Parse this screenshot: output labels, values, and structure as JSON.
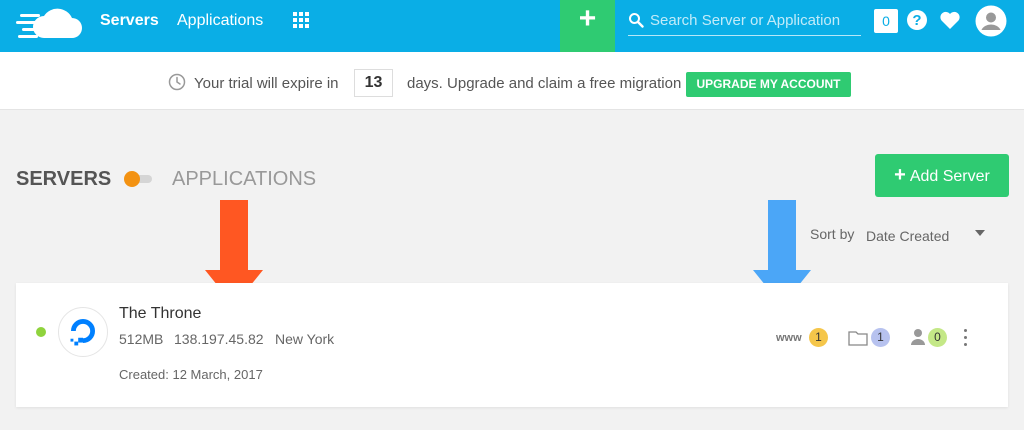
{
  "colors": {
    "topbar": "#0aaee6",
    "accent_green": "#2fcb72",
    "toggle_orange": "#f39212",
    "arrow_orange": "#ff5722",
    "arrow_blue": "#4ba6f7",
    "status_online": "#8fd33d"
  },
  "nav": {
    "servers": "Servers",
    "applications": "Applications",
    "plus": "+",
    "search_placeholder": "Search Server or Application",
    "notifications_count": "0",
    "icons": [
      "apps-grid-icon",
      "search-icon",
      "help-icon",
      "heart-icon",
      "avatar-icon"
    ]
  },
  "trial": {
    "prefix": "Your trial will expire in",
    "days": "13",
    "suffix": "days. Upgrade and claim a free migration",
    "upgrade_label": "UPGRADE MY ACCOUNT"
  },
  "section": {
    "servers_label": "SERVERS",
    "applications_label": "APPLICATIONS",
    "add_server_plus": "+",
    "add_server_label": "Add Server"
  },
  "sort": {
    "label": "Sort by",
    "value": "Date Created"
  },
  "server": {
    "name": "The Throne",
    "size": "512MB",
    "ip": "138.197.45.82",
    "location": "New York",
    "created": "Created: 12 March, 2017",
    "www_label": "www",
    "apps_count": "1",
    "db_count": "1",
    "users_count": "0"
  }
}
